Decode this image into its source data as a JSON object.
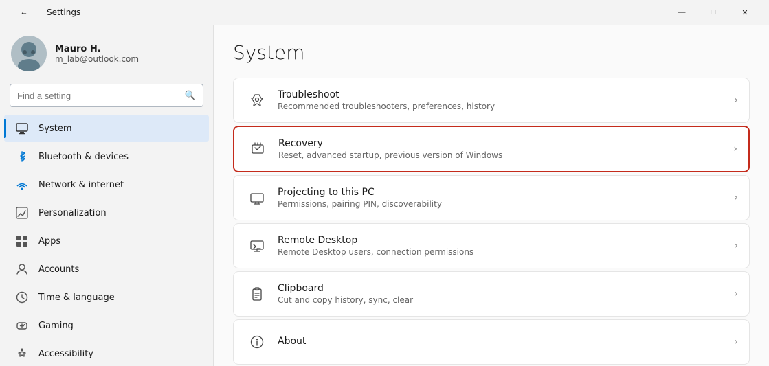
{
  "titleBar": {
    "title": "Settings",
    "back_icon": "←",
    "minimize": "—",
    "maximize": "□",
    "close": "✕"
  },
  "sidebar": {
    "user": {
      "name": "Mauro H.",
      "email": "m_lab@outlook.com",
      "avatar_char": "🧑"
    },
    "search": {
      "placeholder": "Find a setting",
      "icon": "🔍"
    },
    "nav_items": [
      {
        "id": "system",
        "label": "System",
        "icon": "🖥",
        "active": true
      },
      {
        "id": "bluetooth",
        "label": "Bluetooth & devices",
        "icon": "⬡"
      },
      {
        "id": "network",
        "label": "Network & internet",
        "icon": "🌐"
      },
      {
        "id": "personalization",
        "label": "Personalization",
        "icon": "✏"
      },
      {
        "id": "apps",
        "label": "Apps",
        "icon": "⊞"
      },
      {
        "id": "accounts",
        "label": "Accounts",
        "icon": "👤"
      },
      {
        "id": "time",
        "label": "Time & language",
        "icon": "🕐"
      },
      {
        "id": "gaming",
        "label": "Gaming",
        "icon": "🎮"
      },
      {
        "id": "accessibility",
        "label": "Accessibility",
        "icon": "♿"
      }
    ]
  },
  "main": {
    "title": "System",
    "settings": [
      {
        "id": "troubleshoot",
        "title": "Troubleshoot",
        "desc": "Recommended troubleshooters, preferences, history",
        "icon": "🔧",
        "highlighted": false
      },
      {
        "id": "recovery",
        "title": "Recovery",
        "desc": "Reset, advanced startup, previous version of Windows",
        "icon": "💾",
        "highlighted": true
      },
      {
        "id": "projecting",
        "title": "Projecting to this PC",
        "desc": "Permissions, pairing PIN, discoverability",
        "icon": "📺",
        "highlighted": false
      },
      {
        "id": "remote-desktop",
        "title": "Remote Desktop",
        "desc": "Remote Desktop users, connection permissions",
        "icon": "🖧",
        "highlighted": false
      },
      {
        "id": "clipboard",
        "title": "Clipboard",
        "desc": "Cut and copy history, sync, clear",
        "icon": "📋",
        "highlighted": false
      },
      {
        "id": "about",
        "title": "About",
        "desc": "",
        "icon": "ℹ",
        "highlighted": false
      }
    ]
  }
}
